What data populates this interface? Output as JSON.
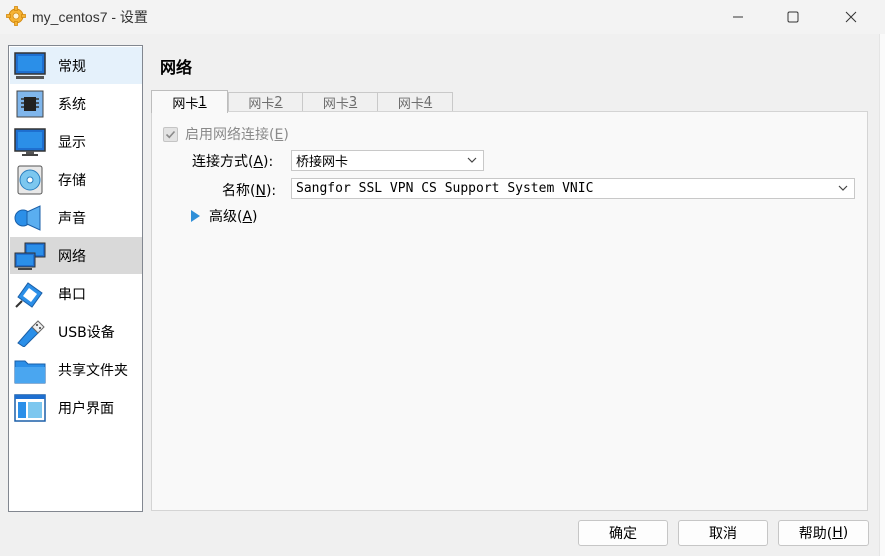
{
  "window": {
    "title": "my_centos7 - 设置",
    "icon": "virtualbox-settings-icon"
  },
  "sidebar": {
    "items": [
      {
        "label": "常规",
        "icon": "general-monitor-icon"
      },
      {
        "label": "系统",
        "icon": "system-chip-icon"
      },
      {
        "label": "显示",
        "icon": "display-monitor-icon"
      },
      {
        "label": "存储",
        "icon": "storage-disc-icon"
      },
      {
        "label": "声音",
        "icon": "audio-speaker-icon"
      },
      {
        "label": "网络",
        "icon": "network-icon"
      },
      {
        "label": "串口",
        "icon": "serial-port-icon"
      },
      {
        "label": "USB设备",
        "icon": "usb-icon"
      },
      {
        "label": "共享文件夹",
        "icon": "shared-folder-icon"
      },
      {
        "label": "用户界面",
        "icon": "user-interface-icon"
      }
    ],
    "selected": "网络",
    "hovered": "常规"
  },
  "main": {
    "title": "网络",
    "tabs": [
      {
        "label": "网卡 ",
        "accel": "1"
      },
      {
        "label": "网卡 ",
        "accel": "2"
      },
      {
        "label": "网卡 ",
        "accel": "3"
      },
      {
        "label": "网卡 ",
        "accel": "4"
      }
    ],
    "enable_checkbox": {
      "label": "启用网络连接(",
      "accel": "E",
      "label_end": ")",
      "checked": true,
      "enabled": false
    },
    "attached_to": {
      "label": "连接方式(",
      "accel": "A",
      "label_end": "):",
      "value": "桥接网卡"
    },
    "name": {
      "label": "名称(",
      "accel": "N",
      "label_end": "):",
      "value": "Sangfor SSL VPN CS Support System VNIC"
    },
    "advanced": {
      "label": "高级(",
      "accel": "A",
      "label_end": ")"
    }
  },
  "buttons": {
    "ok": "确定",
    "cancel": "取消",
    "help": "帮助(",
    "help_accel": "H",
    "help_end": ")"
  },
  "colors": {
    "accent": "#2f8fd8",
    "selected_bg": "#d9d9d9",
    "hover_bg": "#e5f1fb"
  }
}
